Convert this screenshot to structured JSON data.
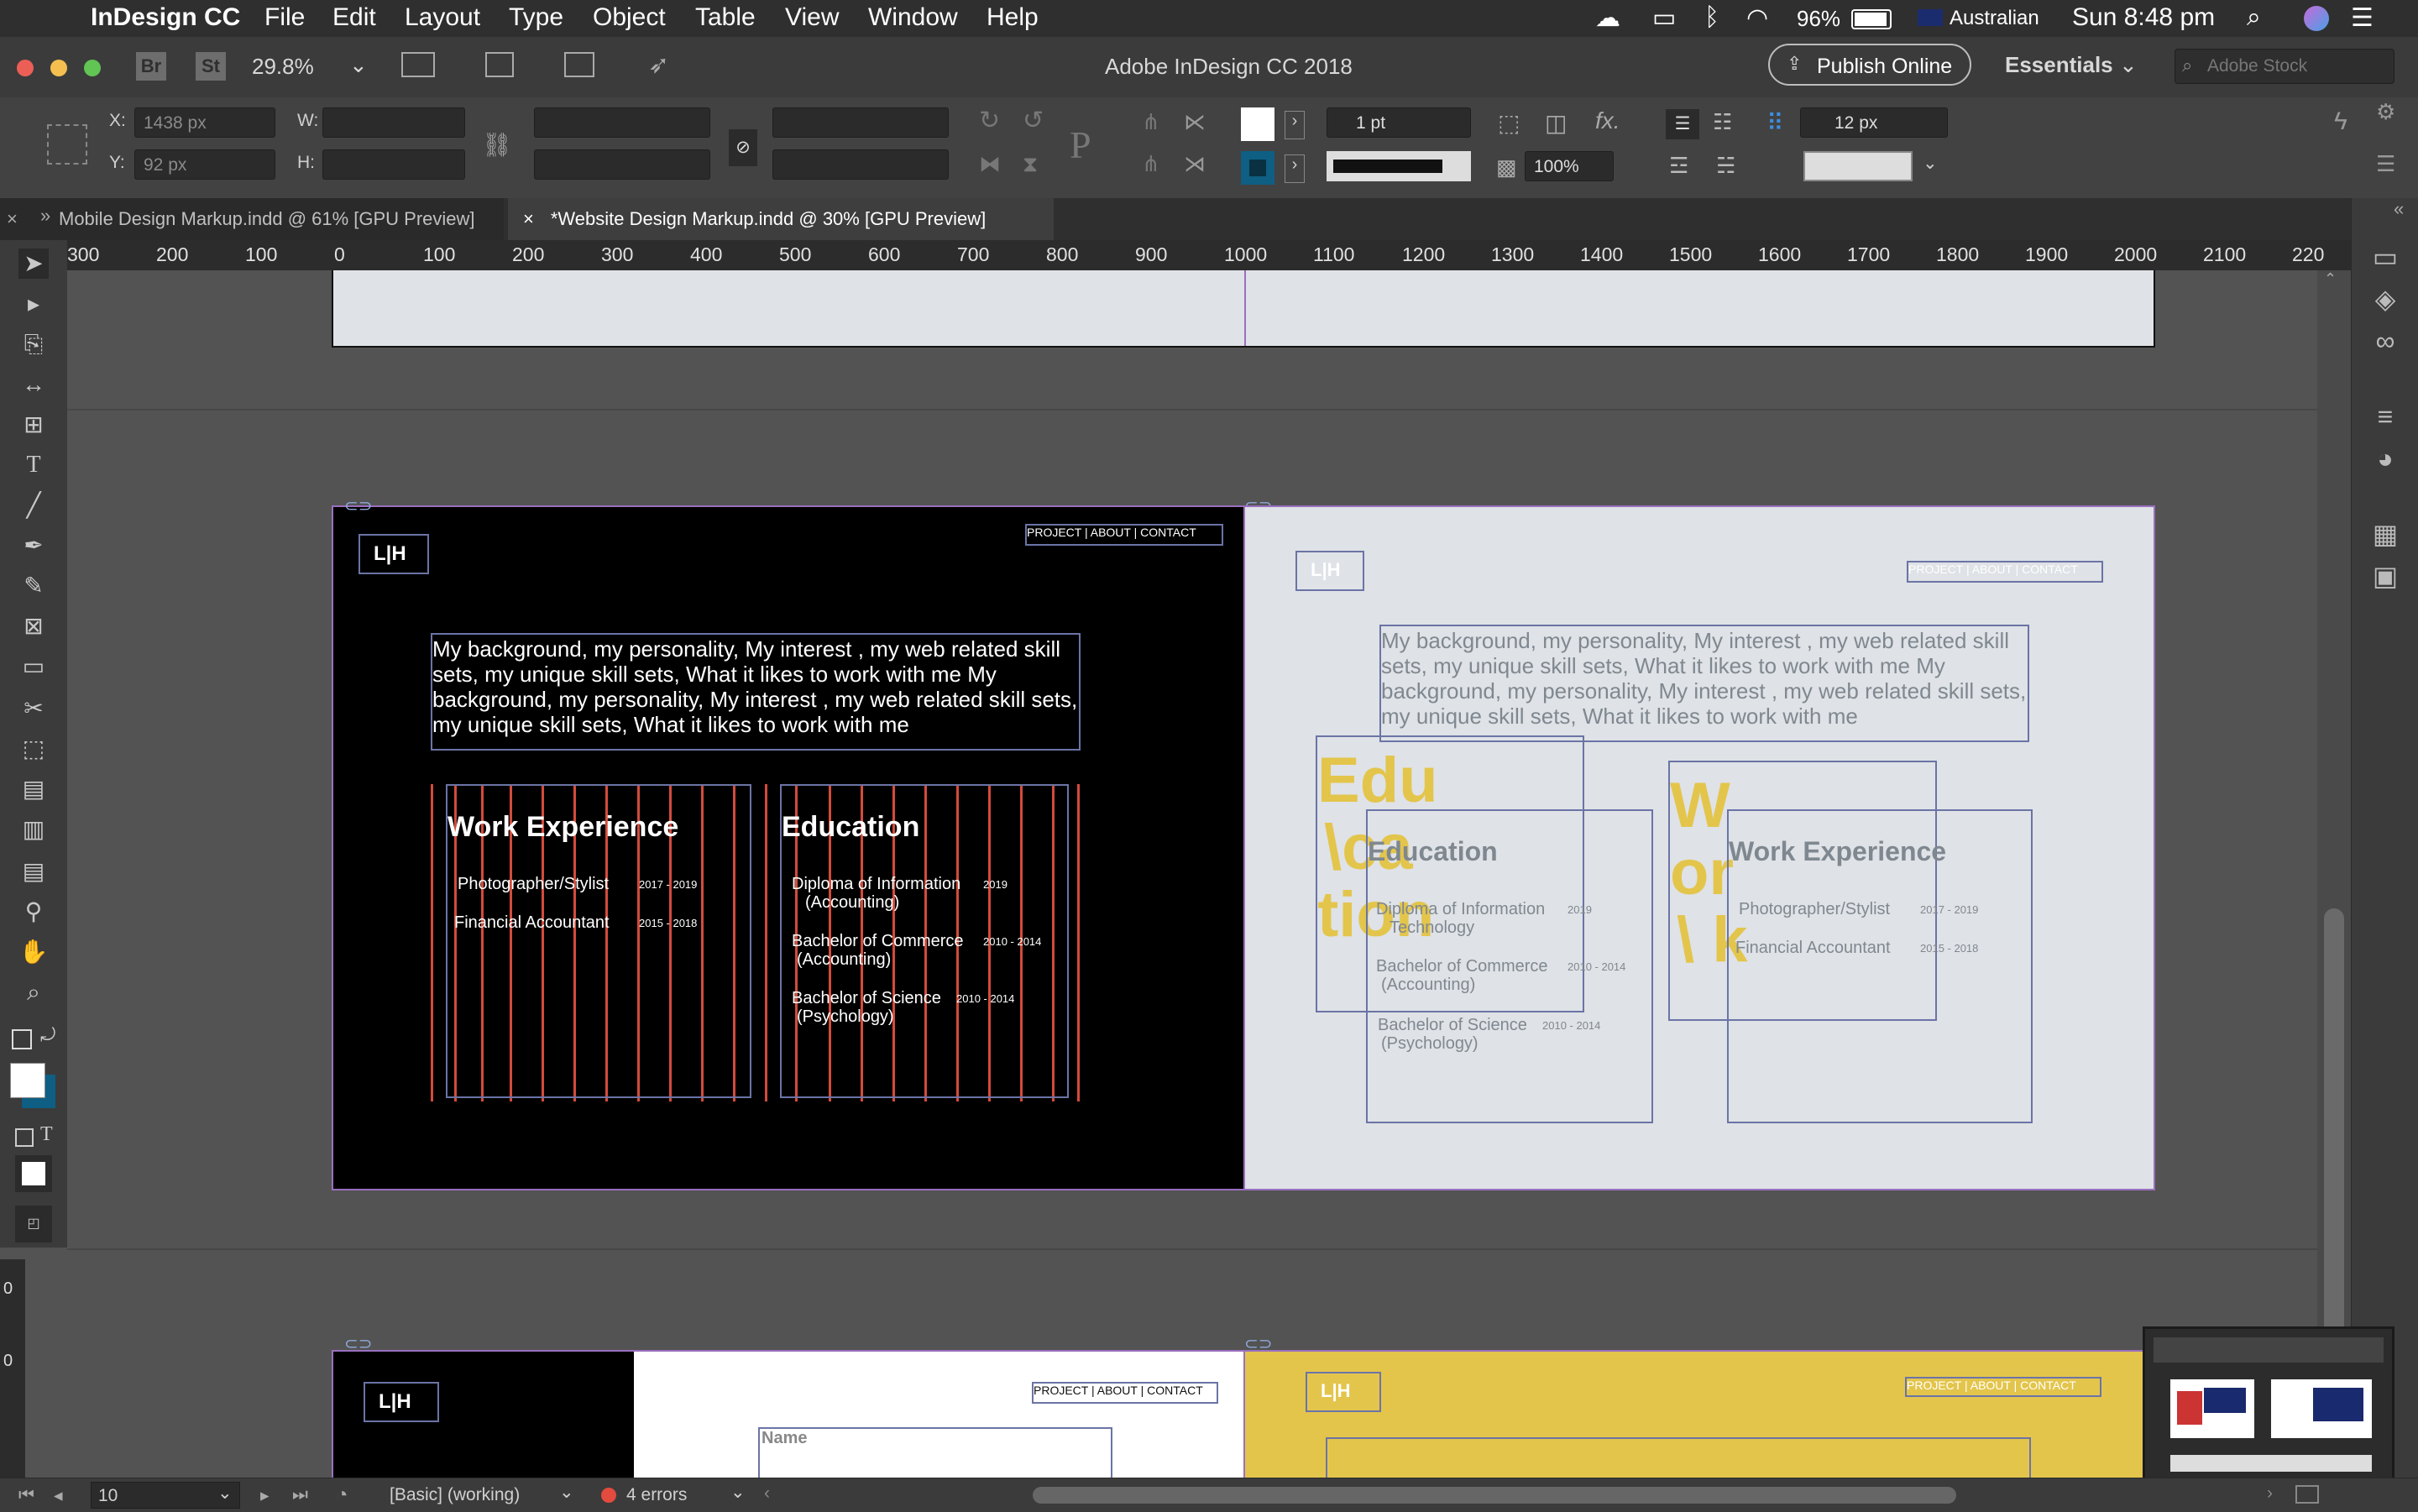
{
  "menubar": {
    "app": "InDesign CC",
    "items": [
      "File",
      "Edit",
      "Layout",
      "Type",
      "Object",
      "Table",
      "View",
      "Window",
      "Help"
    ],
    "battery": "96%",
    "input_source": "Australian",
    "clock": "Sun 8:48 pm"
  },
  "titlebar": {
    "br": "Br",
    "st": "St",
    "zoom": "29.8%",
    "title": "Adobe InDesign CC 2018",
    "publish": "Publish Online",
    "workspace": "Essentials",
    "search_placeholder": "Adobe Stock"
  },
  "control": {
    "x_label": "X:",
    "x_value": "1438 px",
    "y_label": "Y:",
    "y_value": "92 px",
    "w_label": "W:",
    "h_label": "H:",
    "stroke_weight": "1 pt",
    "opacity": "100%",
    "spacing": "12 px",
    "fx": "fx."
  },
  "tabs": [
    {
      "label": "Mobile Design Markup.indd @ 61% [GPU Preview]"
    },
    {
      "label": "*Website Design Markup.indd @ 30% [GPU Preview]",
      "close": "×"
    }
  ],
  "ruler": [
    "300",
    "200",
    "100",
    "0",
    "100",
    "200",
    "300",
    "400",
    "500",
    "600",
    "700",
    "800",
    "900",
    "1000",
    "1100",
    "1200",
    "1300",
    "1400",
    "1500",
    "1600",
    "1700",
    "1800",
    "1900",
    "2000",
    "2100",
    "220"
  ],
  "vruler": [
    "0",
    "0"
  ],
  "spread_dark": {
    "logo": "L|H",
    "nav": "PROJECT |  ABOUT | CONTACT",
    "intro": "My background, my personality, My interest , my web related skill sets, my unique skill sets, What it likes to work with me My background, my personality, My interest , my web related skill sets, my unique skill sets, What it likes to work with me",
    "work_title": "Work Experience",
    "work": [
      {
        "role": "Photographer/Stylist",
        "years": "2017 - 2019"
      },
      {
        "role": "Financial Accountant",
        "years": "2015 - 2018"
      }
    ],
    "edu_title": "Education",
    "edu": [
      {
        "line1": "Diploma of Information",
        "line2": "Technology",
        "years": "2019"
      },
      {
        "line1": "Bachelor of Commerce",
        "line2": "(Accounting)",
        "years": "2010 - 2014"
      },
      {
        "line1": "Bachelor of Science",
        "line2": "(Psychology)",
        "years": "2010 - 2014"
      }
    ]
  },
  "spread_light": {
    "logo": "L|H",
    "nav": "PROJECT |  ABOUT | CONTACT",
    "big_edu": [
      "Edu",
      "\\ca",
      "tion"
    ],
    "big_work": [
      "W",
      "or",
      "\\ k"
    ]
  },
  "spread_bottom": {
    "logo": "L|H",
    "nav": "PROJECT |  ABOUT | CONTACT",
    "name_label": "Name",
    "logo_yellow": "L|H",
    "nav_yellow": "PROJECT |  ABOUT | CONTACT"
  },
  "status": {
    "page": "10",
    "profile": "[Basic] (working)",
    "errors": "4 errors"
  },
  "colors": {
    "accent_yellow": "#e3c54c",
    "guide_red": "#d34b3c",
    "frame_blue": "#6b74a6",
    "page_light": "#dfe2e6"
  }
}
